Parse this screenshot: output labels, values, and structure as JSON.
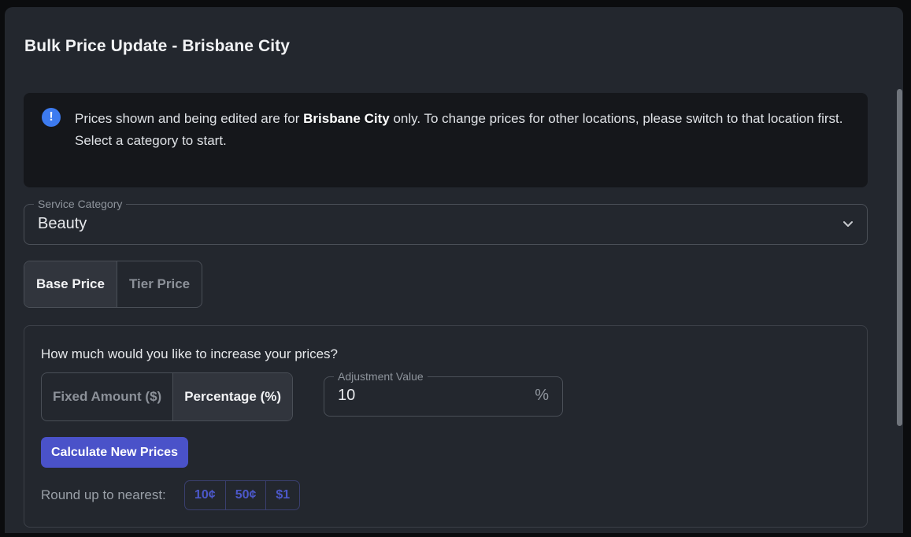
{
  "dialog": {
    "title": "Bulk Price Update - Brisbane City"
  },
  "alert": {
    "icon": "info-icon",
    "text_before": "Prices shown and being edited are for ",
    "location": "Brisbane City",
    "text_after": " only. To change prices for other locations, please switch to that location first.",
    "line2": "Select a category to start.",
    "accent_color": "#3d7bf0"
  },
  "service_category": {
    "label": "Service Category",
    "value": "Beauty"
  },
  "price_mode": {
    "options": [
      "Base Price",
      "Tier Price"
    ],
    "selected": "Base Price"
  },
  "adjustment": {
    "question": "How much would you like to increase your prices?",
    "types": [
      "Fixed Amount ($)",
      "Percentage (%)"
    ],
    "selected_type": "Percentage (%)",
    "value_label": "Adjustment Value",
    "value": "10",
    "unit": "%",
    "calculate_label": "Calculate New Prices",
    "button_color": "#4a52c9"
  },
  "rounding": {
    "label": "Round up to nearest:",
    "options": [
      "10¢",
      "50¢",
      "$1"
    ]
  }
}
